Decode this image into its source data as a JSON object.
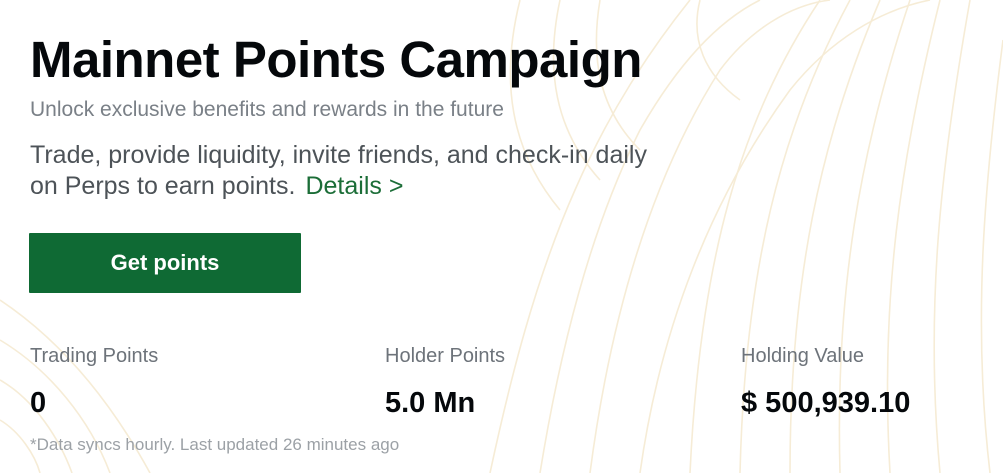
{
  "campaign": {
    "title": "Mainnet Points Campaign",
    "subtitle": "Unlock exclusive benefits and rewards in the future",
    "description_line1": "Trade, provide liquidity, invite friends, and check-in daily",
    "description_line2": "on Perps to earn points.",
    "details_link": "Details >",
    "cta_label": "Get points"
  },
  "stats": {
    "trading": {
      "label": "Trading Points",
      "value": "0"
    },
    "holder": {
      "label": "Holder Points",
      "value": "5.0 Mn"
    },
    "holding": {
      "label": "Holding Value",
      "value": "$ 500,939.10"
    }
  },
  "footnote": "*Data syncs hourly. Last updated 26 minutes ago",
  "colors": {
    "accent": "#0f6a34",
    "link": "#1b6d37",
    "muted_text": "#7a8087",
    "background_lines": "#f6ecd6"
  }
}
